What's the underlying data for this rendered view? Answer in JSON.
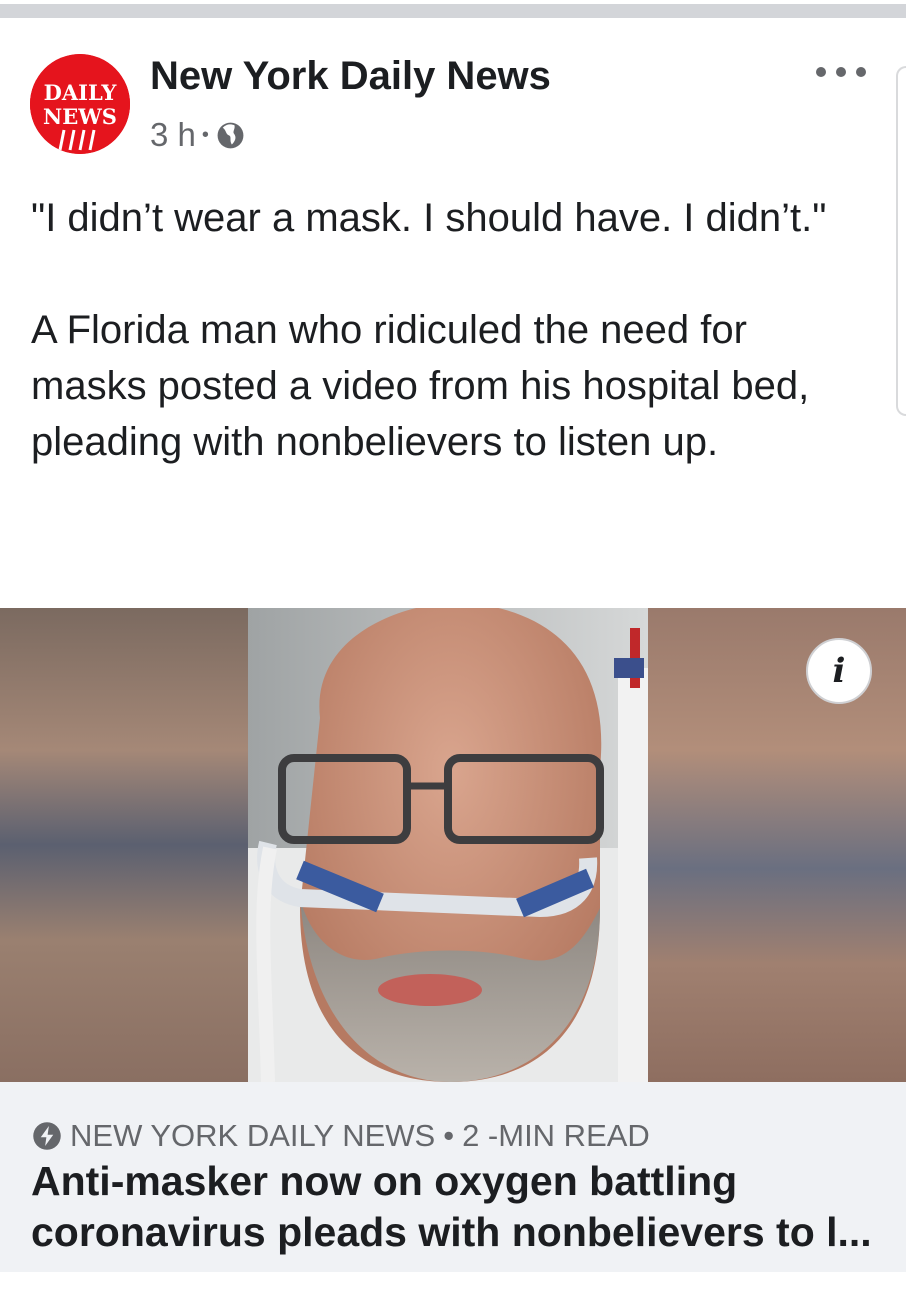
{
  "post": {
    "page_name": "New York Daily News",
    "time": "3 h",
    "separator": "•",
    "avatar_text_line1": "DAILY",
    "avatar_text_line2": "NEWS",
    "caption_quote": "\"I didn’t wear a mask. I should have. I didn’t.\"",
    "caption_body": "A Florida man who ridiculed the need for masks posted a video from his hospital bed, pleading with nonbelievers to listen up."
  },
  "media": {
    "info_label": "i"
  },
  "link_card": {
    "source": "NEW YORK DAILY NEWS",
    "separator": "•",
    "read_time": "2 -MIN READ",
    "headline": "Anti-masker now on oxygen battling coronavirus pleads with nonbelievers to l..."
  },
  "colors": {
    "brand_red": "#e5141d",
    "text_primary": "#1c1e21",
    "text_secondary": "#65676b",
    "card_bg": "#f0f2f5"
  },
  "icons": [
    "globe-icon",
    "more-icon",
    "info-icon",
    "bolt-icon"
  ]
}
